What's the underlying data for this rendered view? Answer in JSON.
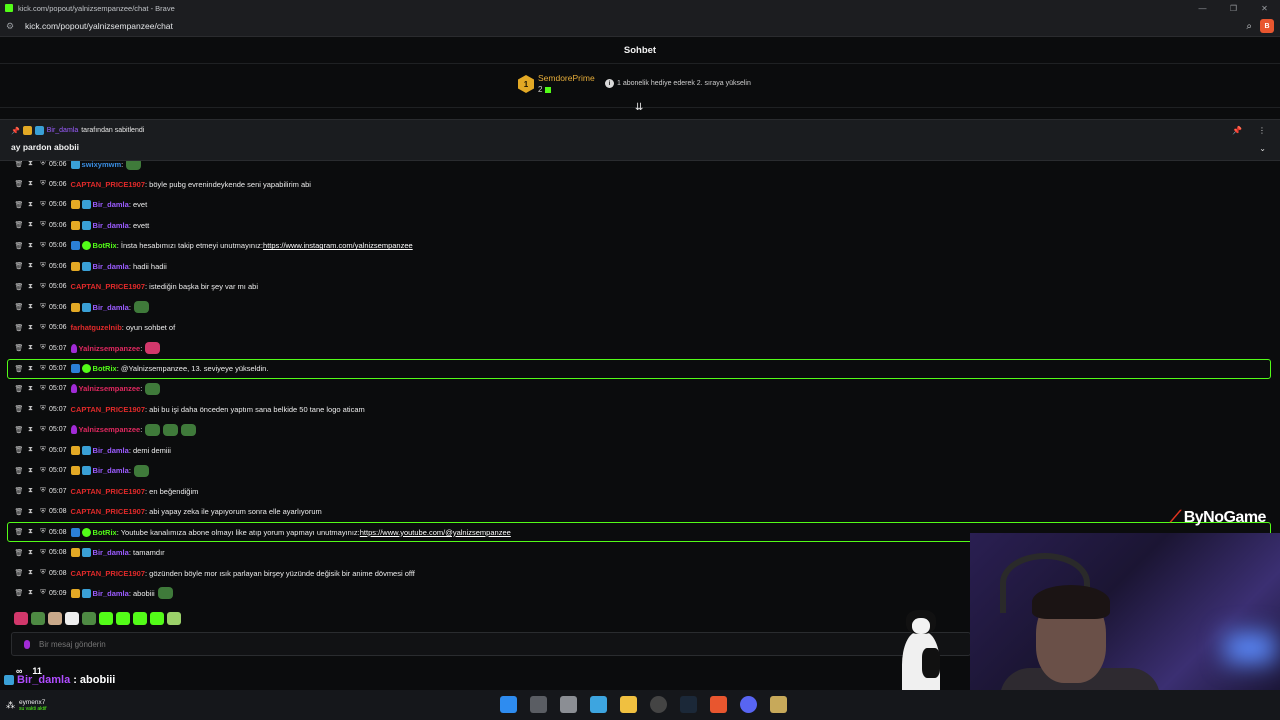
{
  "browser": {
    "title": "kick.com/popout/yalnizsempanzee/chat - Brave",
    "url": "kick.com/popout/yalnizsempanzee/chat"
  },
  "chat": {
    "header": "Sohbet",
    "leaderboard": {
      "rank": "1",
      "user": "SemdorePrime",
      "count": "2",
      "info": "1 abonelik hediye ederek 2. sıraya yükselin"
    },
    "pinned": {
      "user": "Bir_damla",
      "by_text": "tarafından sabitlendi",
      "message": "ay pardon abobii"
    },
    "messages": [
      {
        "time": "05:06",
        "user": "swixymwm",
        "color": "#3a8de0",
        "text": ":",
        "badges": [
          "sub"
        ],
        "emote": true
      },
      {
        "time": "05:06",
        "user": "CAPTAN_PRICE1907",
        "color": "#e02a2a",
        "text": ": böyle pubg evrenindeykende seni yapabilirim abi",
        "badges": []
      },
      {
        "time": "05:06",
        "user": "Bir_damla",
        "color": "#9b5cff",
        "text": ": evet",
        "badges": [
          "crown",
          "sub"
        ]
      },
      {
        "time": "05:06",
        "user": "Bir_damla",
        "color": "#9b5cff",
        "text": ": evett",
        "badges": [
          "crown",
          "sub"
        ]
      },
      {
        "time": "05:06",
        "user": "BotRix",
        "color": "#53fc18",
        "text": ": İnsta hesabımızı takip etmeyi unutmayınız: ",
        "link": "https://www.instagram.com/yalnizsempanzee",
        "badges": [
          "bot",
          "ver"
        ]
      },
      {
        "time": "05:06",
        "user": "Bir_damla",
        "color": "#9b5cff",
        "text": ": hadii hadii",
        "badges": [
          "crown",
          "sub"
        ]
      },
      {
        "time": "05:06",
        "user": "CAPTAN_PRICE1907",
        "color": "#e02a2a",
        "text": ": istediğin başka bir şey var mı abi",
        "badges": []
      },
      {
        "time": "05:06",
        "user": "Bir_damla",
        "color": "#9b5cff",
        "text": ":",
        "badges": [
          "crown",
          "sub"
        ],
        "emote": true
      },
      {
        "time": "05:06",
        "user": "farhatguzelnib",
        "color": "#e02a2a",
        "text": ": oyun sohbet of",
        "badges": []
      },
      {
        "time": "05:07",
        "user": "Yalnizsempanzee",
        "color": "#e0285f",
        "text": ":",
        "badges": [
          "mic"
        ],
        "emote_pink": true
      },
      {
        "time": "05:07",
        "user": "BotRix",
        "color": "#53fc18",
        "text": ": @Yalnizsempanzee, 13. seviyeye yükseldin.",
        "badges": [
          "bot",
          "ver"
        ],
        "highlight": true
      },
      {
        "time": "05:07",
        "user": "Yalnizsempanzee",
        "color": "#e0285f",
        "text": ":",
        "badges": [
          "mic"
        ],
        "emote": true
      },
      {
        "time": "05:07",
        "user": "CAPTAN_PRICE1907",
        "color": "#e02a2a",
        "text": ": abi bu işi daha önceden yaptım sana belkide 50 tane logo aticam",
        "badges": []
      },
      {
        "time": "05:07",
        "user": "Yalnizsempanzee",
        "color": "#e0285f",
        "text": ":",
        "badges": [
          "mic"
        ],
        "emote3": true
      },
      {
        "time": "05:07",
        "user": "Bir_damla",
        "color": "#9b5cff",
        "text": ": demi demiii",
        "badges": [
          "crown",
          "sub"
        ]
      },
      {
        "time": "05:07",
        "user": "Bir_damla",
        "color": "#9b5cff",
        "text": ":",
        "badges": [
          "crown",
          "sub"
        ],
        "emote": true
      },
      {
        "time": "05:07",
        "user": "CAPTAN_PRICE1907",
        "color": "#e02a2a",
        "text": ": en beğendiğim",
        "badges": []
      },
      {
        "time": "05:08",
        "user": "CAPTAN_PRICE1907",
        "color": "#e02a2a",
        "text": ": abi yapay zeka ile yapıyorum sonra elle ayarlıyorum",
        "badges": []
      },
      {
        "time": "05:08",
        "user": "BotRix",
        "color": "#53fc18",
        "text": ": Youtube kanalımıza abone olmayı like atıp yorum yapmayı unutmayınız: ",
        "link": "https://www.youtube.com/@yalnizsempanzee",
        "badges": [
          "bot",
          "ver"
        ],
        "highlight": true
      },
      {
        "time": "05:08",
        "user": "Bir_damla",
        "color": "#9b5cff",
        "text": ": tamamdır",
        "badges": [
          "crown",
          "sub"
        ]
      },
      {
        "time": "05:08",
        "user": "CAPTAN_PRICE1907",
        "color": "#e02a2a",
        "text": ": gözünden böyle mor ısık parlayan birşey yüzünde değisik bir anime dövmesi offf",
        "badges": []
      },
      {
        "time": "05:09",
        "user": "Bir_damla",
        "color": "#9b5cff",
        "text": ": abobiii",
        "badges": [
          "crown",
          "sub"
        ],
        "emote": true
      }
    ],
    "input_placeholder": "Bir mesaj gönderin"
  },
  "overlay": {
    "brand": "ByNoGame",
    "infinity": "∞",
    "count": "11",
    "last_user": "Bir_damla",
    "last_msg": ": abobiii"
  },
  "taskbar": {
    "user": "eymenx7",
    "status": "su vakti aktif"
  }
}
